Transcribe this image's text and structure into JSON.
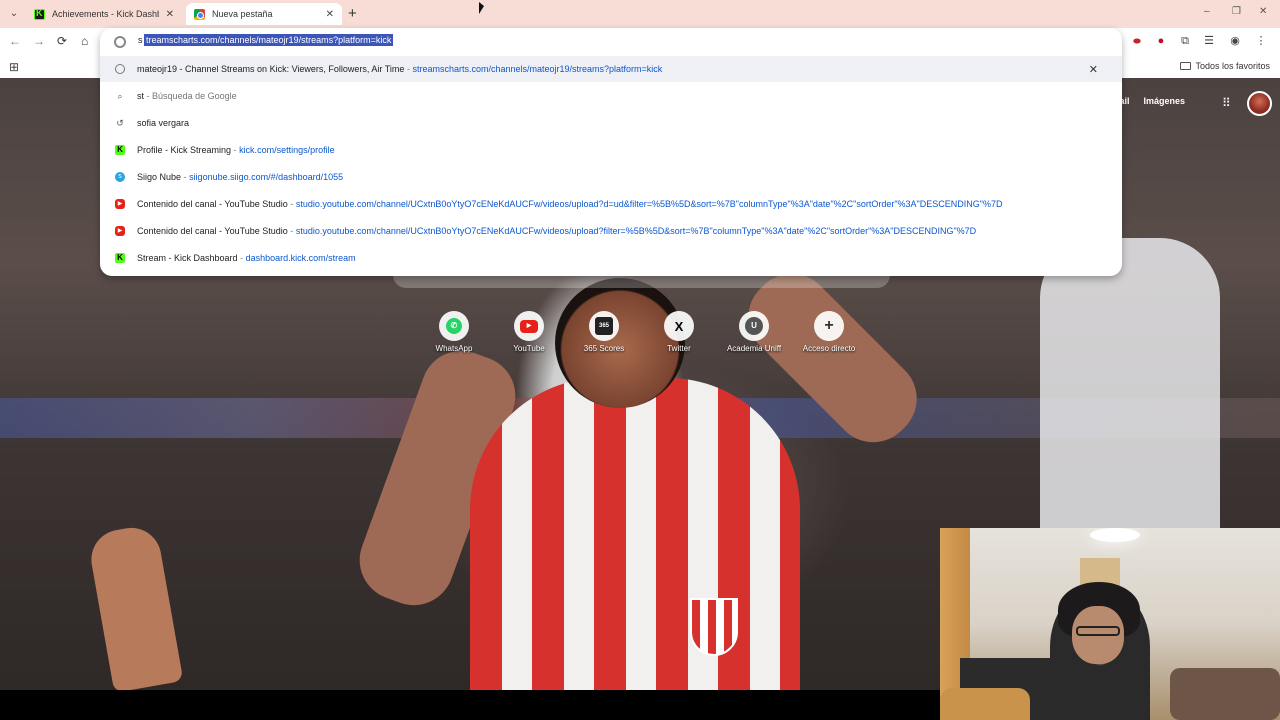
{
  "browser": {
    "tabs": [
      {
        "title": "Achievements - Kick Dashboard",
        "icon": "kick-icon"
      },
      {
        "title": "Nueva pestaña",
        "icon": "chrome-icon",
        "active": true
      }
    ],
    "new_tab_symbol": "+",
    "window_controls": {
      "minimize": "–",
      "restore": "❐",
      "close": "✕"
    },
    "nav": {
      "back": "←",
      "forward": "→",
      "reload": "⟳",
      "home": "⌂"
    }
  },
  "omnibox": {
    "typed": "s",
    "selected_completion": "treamscharts.com/channels/mateojr19/streams?platform=kick",
    "suggestions": [
      {
        "icon": "globe-icon",
        "title": "mateojr19 - Channel Streams on Kick: Viewers, Followers, Air Time",
        "url": "streamscharts.com/channels/mateojr19/streams?platform=kick",
        "removable": true
      },
      {
        "icon": "search-icon",
        "title": "st",
        "sep": "-",
        "url": "Búsqueda de Google",
        "plain_url": true
      },
      {
        "icon": "history-icon",
        "title": "sofia vergara",
        "url": ""
      },
      {
        "icon": "kick-icon",
        "title": "Profile - Kick Streaming",
        "url": "kick.com/settings/profile"
      },
      {
        "icon": "siigo-icon",
        "title": "Siigo Nube",
        "url": "siigonube.siigo.com/#/dashboard/1055"
      },
      {
        "icon": "youtube-icon",
        "title": "Contenido del canal - YouTube Studio",
        "url": "studio.youtube.com/channel/UCxtnB0oYtyO7cENeKdAUCFw/videos/upload?d=ud&filter=%5B%5D&sort=%7B\"columnType\"%3A\"date\"%2C\"sortOrder\"%3A\"DESCENDING\"%7D"
      },
      {
        "icon": "youtube-icon",
        "title": "Contenido del canal - YouTube Studio",
        "url": "studio.youtube.com/channel/UCxtnB0oYtyO7cENeKdAUCFw/videos/upload?filter=%5B%5D&sort=%7B\"columnType\"%3A\"date\"%2C\"sortOrder\"%3A\"DESCENDING\"%7D"
      },
      {
        "icon": "kick-icon",
        "title": "Stream - Kick Dashboard",
        "url": "dashboard.kick.com/stream"
      }
    ],
    "dismiss_symbol": "✕"
  },
  "bookmarks": {
    "folder_label": "Todos los favoritos"
  },
  "new_tab_page": {
    "header_links": [
      "Gmail",
      "Imágenes"
    ],
    "shortcuts": [
      {
        "label": "WhatsApp",
        "icon": "whatsapp-icon",
        "glyph": "✆"
      },
      {
        "label": "YouTube",
        "icon": "youtube-icon",
        "glyph": "▶"
      },
      {
        "label": "365 Scores",
        "icon": "scores-icon",
        "glyph": "365"
      },
      {
        "label": "Twitter",
        "icon": "x-icon",
        "glyph": "X"
      },
      {
        "label": "Academia Uniff",
        "icon": "u-icon",
        "glyph": "U"
      },
      {
        "label": "Acceso directo",
        "icon": "add-icon",
        "glyph": "+"
      }
    ]
  },
  "colors": {
    "tabstrip": "#f7ddd6",
    "selection": "#3b56b8",
    "url": "#0b57d0",
    "kick_green": "#53fc18"
  }
}
